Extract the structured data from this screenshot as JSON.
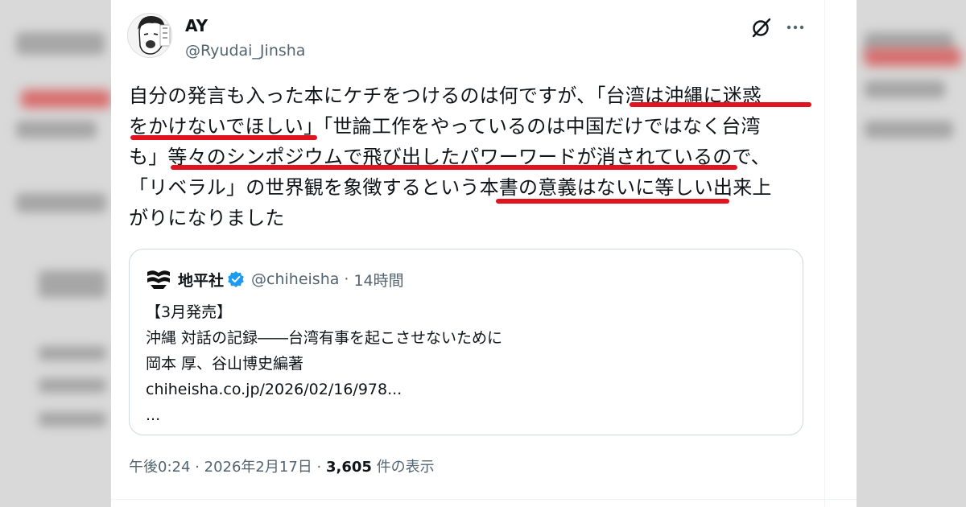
{
  "tweet": {
    "display_name": "AY",
    "handle": "@Ryudai_Jinsha",
    "text_lines": [
      "自分の発言も入った本にケチをつけるのは何ですが、「台湾は沖縄に迷惑",
      "をかけないでほしい」「世論工作をやっているのは中国だけではなく台湾",
      "も」等々のシンポジウムで飛び出したパワーワードが消されているので、",
      "「リベラル」の世界観を象徴するという本書の意義はないに等しい出来上",
      "がりになりました"
    ],
    "underlined_phrases": [
      "台湾は沖縄に迷惑をかけないでほしい",
      "等々のシンポジウムで飛び出したパワーワードが消されている",
      "本書の意義はないに等しい"
    ],
    "footer": {
      "time": "午後0:24",
      "separator": "·",
      "date": "2026年2月17日",
      "views_count": "3,605",
      "views_label": "件の表示"
    }
  },
  "quoted_tweet": {
    "name": "地平社",
    "handle": "@chiheisha",
    "separator": "·",
    "time": "14時間",
    "lines": [
      "【3月発売】",
      "沖縄 対話の記録――台湾有事を起こさせないために",
      "岡本 厚、谷山博史編著",
      "chiheisha.co.jp/2026/02/16/978...",
      "..."
    ]
  },
  "icons": {
    "grok": "grok-icon",
    "more": "more-icon",
    "verified": "verified-badge-icon",
    "publisher_logo": "chiheisha-logo-icon"
  },
  "colors": {
    "text": "#0f1419",
    "secondary": "#536471",
    "verified": "#1d9bf0",
    "underline": "#e0131f",
    "border": "#cfd9de"
  }
}
